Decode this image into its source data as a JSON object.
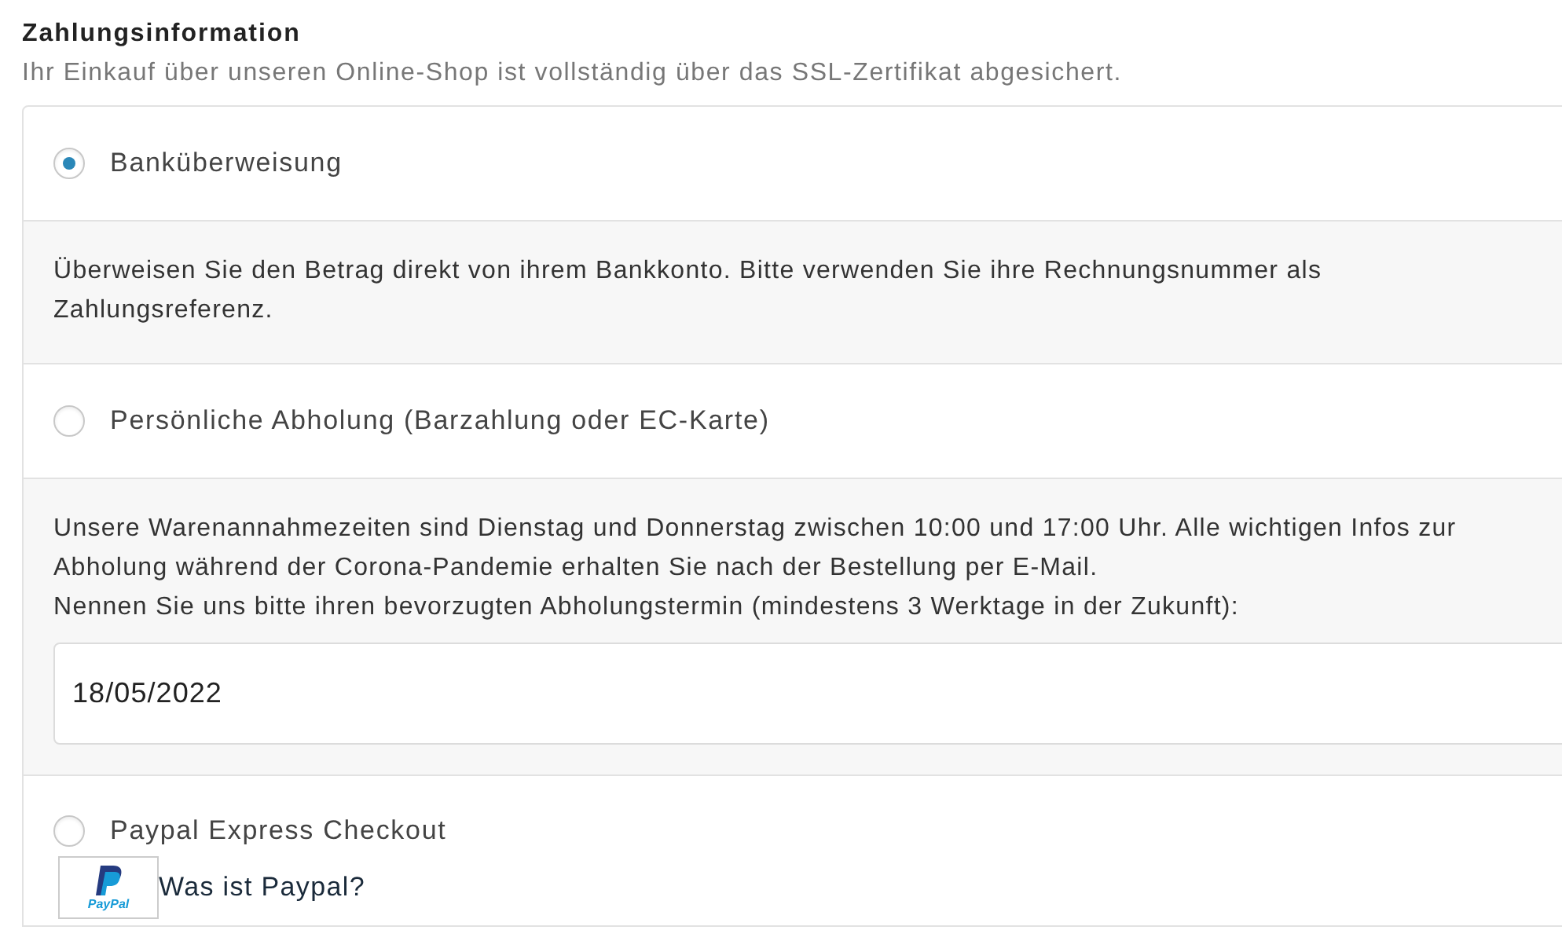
{
  "heading": "Zahlungsinformation",
  "subtitle": "Ihr Einkauf über unseren Online-Shop ist vollständig über das SSL-Zertifikat abgesichert.",
  "payment_options": [
    {
      "label": "Banküberweisung",
      "selected": true,
      "details": [
        "Überweisen Sie den Betrag direkt von ihrem Bankkonto. Bitte verwenden Sie ihre Rechnungsnummer als Zahlungsreferenz."
      ]
    },
    {
      "label": "Persönliche Abholung (Barzahlung oder EC-Karte)",
      "selected": false,
      "details": [
        "Unsere Warenannahmezeiten sind Dienstag und Donnerstag zwischen 10:00 und 17:00 Uhr. Alle wichtigen Infos zur Abholung während der Corona-Pandemie erhalten Sie nach der Bestellung per E-Mail.",
        "Nennen Sie uns bitte ihren bevorzugten Abholungstermin (mindestens 3 Werktage in der Zukunft):"
      ],
      "date_field": {
        "value": "18/05/2022"
      }
    },
    {
      "label": "Paypal Express Checkout",
      "selected": false,
      "logo_text": "PayPal",
      "link": "Was ist Paypal?"
    }
  ]
}
